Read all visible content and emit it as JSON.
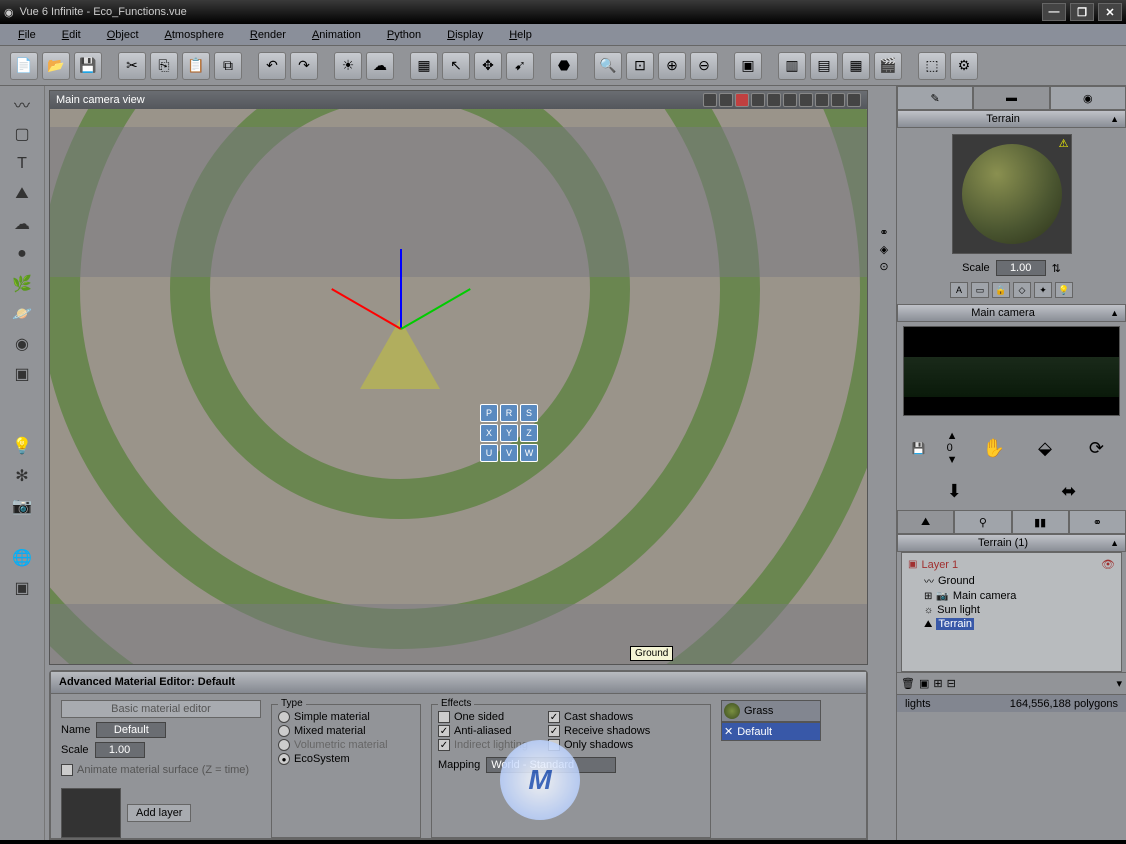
{
  "titlebar": {
    "title": "Vue 6 Infinite - Eco_Functions.vue"
  },
  "menu": [
    {
      "key": "F",
      "rest": "ile"
    },
    {
      "key": "E",
      "rest": "dit"
    },
    {
      "key": "O",
      "rest": "bject"
    },
    {
      "key": "A",
      "rest": "tmosphere"
    },
    {
      "key": "R",
      "rest": "ender"
    },
    {
      "key": "A",
      "rest": "nimation"
    },
    {
      "key": "P",
      "rest": "ython"
    },
    {
      "key": "D",
      "rest": "isplay"
    },
    {
      "key": "H",
      "rest": "elp"
    }
  ],
  "viewport": {
    "title": "Main camera view",
    "tooltip": "Ground"
  },
  "material_editor": {
    "title": "Advanced Material Editor: Default",
    "basic_btn": "Basic material editor",
    "name_label": "Name",
    "name_value": "Default",
    "scale_label": "Scale",
    "scale_value": "1.00",
    "animate_label": "Animate material surface (Z = time)",
    "add_layer_btn": "Add layer",
    "type": {
      "legend": "Type",
      "simple": "Simple material",
      "mixed": "Mixed material",
      "volumetric": "Volumetric material",
      "ecosystem": "EcoSystem"
    },
    "effects": {
      "legend": "Effects",
      "one_sided": "One sided",
      "anti_aliased": "Anti-aliased",
      "indirect": "Indirect lighting",
      "cast_shadows": "Cast shadows",
      "receive_shadows": "Receive shadows",
      "only_shadows": "Only shadows",
      "mapping_label": "Mapping",
      "mapping_value": "World - Standard"
    },
    "layer_list": {
      "grass": "Grass",
      "default": "Default"
    }
  },
  "right": {
    "terrain_header": "Terrain",
    "scale_label": "Scale",
    "scale_value": "1.00",
    "camera_header": "Main camera",
    "tree_header": "Terrain (1)",
    "tree": {
      "layer1": "Layer 1",
      "ground": "Ground",
      "main_camera": "Main camera",
      "sun_light": "Sun light",
      "terrain": "Terrain"
    }
  },
  "status": {
    "lights": "lights",
    "polys": "164,556,188 polygons"
  }
}
